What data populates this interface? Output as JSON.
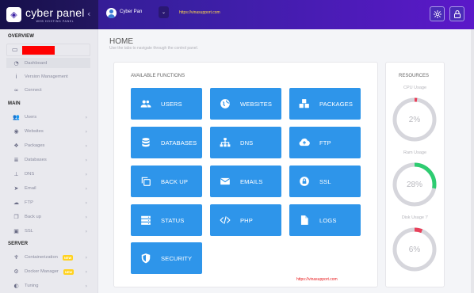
{
  "header": {
    "brand_name": "cyber panel",
    "brand_sub": "WEB HOSTING PANEL",
    "collapse_icon": "chevron-left-icon",
    "user_name": "Cyber Pan",
    "url_text": "https://vinasupport.com",
    "actions": [
      {
        "icon": "gear-icon"
      },
      {
        "icon": "lock-icon"
      }
    ]
  },
  "sidebar": {
    "overview_label": "OVERVIEW",
    "main_label": "MAIN",
    "server_label": "SERVER",
    "overview_items": [
      {
        "label": "Dashboard",
        "icon": "tachometer-icon"
      },
      {
        "label": "Version Management",
        "icon": "info-icon"
      },
      {
        "label": "Connect",
        "icon": "link-icon"
      }
    ],
    "main_items": [
      {
        "label": "Users",
        "icon": "users-icon"
      },
      {
        "label": "Websites",
        "icon": "globe-icon"
      },
      {
        "label": "Packages",
        "icon": "cubes-icon"
      },
      {
        "label": "Databases",
        "icon": "database-icon"
      },
      {
        "label": "DNS",
        "icon": "sitemap-icon"
      },
      {
        "label": "Email",
        "icon": "paper-plane-icon"
      },
      {
        "label": "FTP",
        "icon": "cloud-upload-icon"
      },
      {
        "label": "Back up",
        "icon": "copy-icon"
      },
      {
        "label": "SSL",
        "icon": "lock-icon"
      }
    ],
    "server_items": [
      {
        "label": "Containerization",
        "icon": "docker-icon",
        "badge": "NEW"
      },
      {
        "label": "Docker Manager",
        "icon": "cogs-icon",
        "badge": "NEW"
      },
      {
        "label": "Tuning",
        "icon": "adjust-icon"
      }
    ]
  },
  "main": {
    "title": "HOME",
    "subtitle": "Use the tabs to navigate through the control panel.",
    "functions_title": "AVAILABLE FUNCTIONS",
    "tiles": [
      {
        "label": "USERS",
        "icon": "users-icon"
      },
      {
        "label": "WEBSITES",
        "icon": "globe-icon"
      },
      {
        "label": "PACKAGES",
        "icon": "cubes-icon"
      },
      {
        "label": "DATABASES",
        "icon": "database-icon"
      },
      {
        "label": "DNS",
        "icon": "sitemap-icon"
      },
      {
        "label": "FTP",
        "icon": "cloud-upload-icon"
      },
      {
        "label": "BACK UP",
        "icon": "copy-icon"
      },
      {
        "label": "EMAILS",
        "icon": "envelope-icon"
      },
      {
        "label": "SSL",
        "icon": "lock-icon"
      },
      {
        "label": "STATUS",
        "icon": "server-icon"
      },
      {
        "label": "PHP",
        "icon": "code-icon"
      },
      {
        "label": "LOGS",
        "icon": "file-icon"
      },
      {
        "label": "SECURITY",
        "icon": "shield-icon"
      }
    ],
    "watermark": "https://vinasupport.com"
  },
  "resources": {
    "title": "RESOURCES",
    "cpu_label": "CPU Usage",
    "cpu_value": "2%",
    "cpu_percent": 2,
    "ram_label": "Ram Usage",
    "ram_value": "28%",
    "ram_percent": 28,
    "disk_label": "Disk Usage '/'",
    "disk_value": "6%",
    "disk_percent": 6,
    "colors": {
      "track": "#d6d6dc",
      "cpu": "#e8415a",
      "ram": "#2ecc71",
      "disk": "#e8415a"
    }
  },
  "colors": {
    "tile": "#2e95ea",
    "header": "#3a1fa3",
    "badge": "#ffd21f"
  }
}
